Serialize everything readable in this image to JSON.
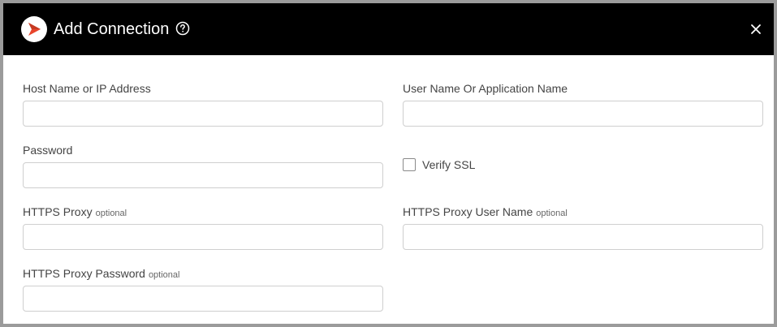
{
  "dialog": {
    "title": "Add Connection",
    "close_icon": "close-icon",
    "help_icon": "help-circle-icon",
    "logo_icon": "brand-logo-icon"
  },
  "form": {
    "host": {
      "label": "Host Name or IP Address",
      "value": "",
      "placeholder": ""
    },
    "user": {
      "label": "User Name Or Application Name",
      "value": "",
      "placeholder": ""
    },
    "password": {
      "label": "Password",
      "value": "",
      "placeholder": ""
    },
    "verify_ssl": {
      "label": "Verify SSL",
      "checked": false
    },
    "https_proxy": {
      "label": "HTTPS Proxy",
      "optional": "optional",
      "value": "",
      "placeholder": ""
    },
    "https_proxy_user": {
      "label": "HTTPS Proxy User Name",
      "optional": "optional",
      "value": "",
      "placeholder": ""
    },
    "https_proxy_password": {
      "label": "HTTPS Proxy Password",
      "optional": "optional",
      "value": "",
      "placeholder": ""
    }
  },
  "colors": {
    "header_bg": "#000000",
    "logo_accent": "#e8452c",
    "input_border": "#cfcfcf"
  }
}
